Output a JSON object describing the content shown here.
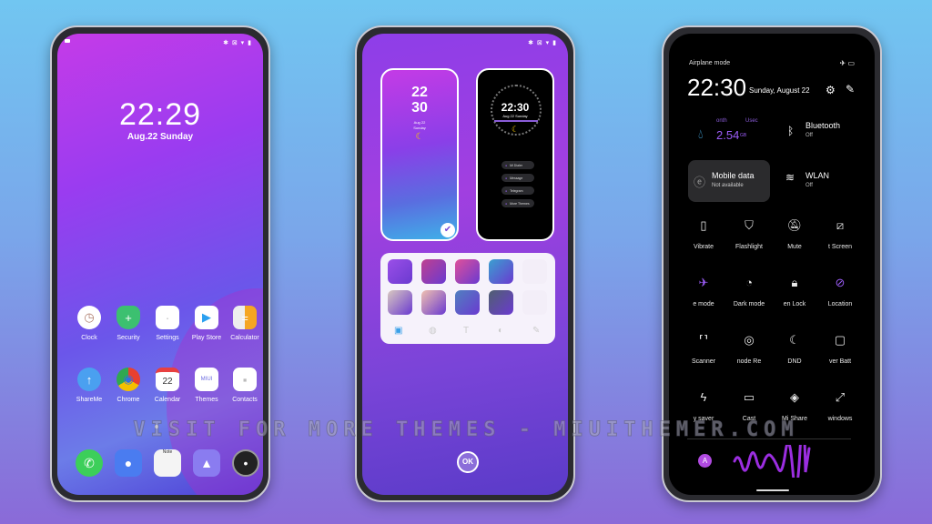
{
  "home": {
    "status_icons": "✱ ⊠ ▾ ▮",
    "time": "22:29",
    "date": "Aug.22  Sunday",
    "apps": [
      {
        "label": "Clock",
        "icon": "clock-icon",
        "glyph": "◷"
      },
      {
        "label": "Security",
        "icon": "shield-icon",
        "glyph": "+"
      },
      {
        "label": "Settings",
        "icon": "settings-icon",
        "glyph": "·"
      },
      {
        "label": "Play Store",
        "icon": "play-store-icon",
        "glyph": "▶"
      },
      {
        "label": "Calculator",
        "icon": "calculator-icon",
        "glyph": "="
      },
      {
        "label": "ShareMe",
        "icon": "shareme-icon",
        "glyph": "↑"
      },
      {
        "label": "Chrome",
        "icon": "chrome-icon",
        "glyph": "◉"
      },
      {
        "label": "Calendar",
        "icon": "calendar-icon",
        "glyph": "22"
      },
      {
        "label": "Themes",
        "icon": "themes-icon",
        "glyph": "MIUI"
      },
      {
        "label": "Contacts",
        "icon": "contacts-icon",
        "glyph": "▪"
      }
    ],
    "dock": [
      {
        "icon": "phone-icon",
        "glyph": "✆",
        "color": "#3ccf5a"
      },
      {
        "icon": "message-icon",
        "glyph": "●",
        "color": "#4a7cf0"
      },
      {
        "icon": "notes-icon",
        "glyph": "Note",
        "color": "#f4f4f4"
      },
      {
        "icon": "gallery-icon",
        "glyph": "▲",
        "color": "#8a7cf0"
      },
      {
        "icon": "camera-icon",
        "glyph": "•",
        "color": "#222"
      }
    ]
  },
  "themes": {
    "status_icons": "✱ ⊠ ▾ ▮",
    "lock_hour": "22",
    "lock_minute": "30",
    "lock_date": "Aug 22",
    "lock_day": "Sunday",
    "aod_time": "22:30",
    "aod_date": "Aug 22  Sunday",
    "aod_shortcuts": [
      "Mi Dialer",
      "Message",
      "Telegram",
      "More Themes"
    ],
    "ok_label": "OK",
    "thumb_colors": [
      "#9b4fe8",
      "#c04090",
      "#e0509a",
      "#3aa0d0",
      "#f3eef8",
      "#d9c8c0",
      "#f0c0b0",
      "#5080c0",
      "#506070",
      "#f3eef8"
    ],
    "tools": [
      "image-icon",
      "globe-icon",
      "text-icon",
      "palette-icon",
      "pen-icon"
    ]
  },
  "control_center": {
    "airplane_label": "Airplane mode",
    "time": "22:30",
    "date": "Sunday, August 22",
    "data_month": "onth",
    "data_used": "Usec",
    "data_value": "2.54",
    "data_unit": "GB",
    "bluetooth_label": "Bluetooth",
    "bluetooth_state": "Off",
    "mobile_label": "Mobile data",
    "mobile_state": "Not available",
    "wlan_label": "WLAN",
    "wlan_state": "Off",
    "accent": "#9b5cf6",
    "toggles": [
      {
        "label": "Vibrate",
        "glyph": "▯",
        "name": "vibrate-icon",
        "active": false
      },
      {
        "label": "Flashlight",
        "glyph": "⛉",
        "name": "flashlight-icon",
        "active": false
      },
      {
        "label": "Mute",
        "glyph": "🔕︎",
        "name": "mute-icon",
        "active": false
      },
      {
        "label": "t    Screen",
        "glyph": "⧄",
        "name": "screenshot-icon",
        "active": false
      },
      {
        "label": "e mode",
        "glyph": "✈",
        "name": "airplane-icon",
        "active": true
      },
      {
        "label": "Dark mode",
        "glyph": "◔",
        "name": "dark-mode-icon",
        "active": false
      },
      {
        "label": "en    Lock",
        "glyph": "🔒︎",
        "name": "lock-icon",
        "active": false
      },
      {
        "label": "Location",
        "glyph": "⊘",
        "name": "location-icon",
        "active": true
      },
      {
        "label": "Scanner",
        "glyph": "⸢⸣",
        "name": "scanner-icon",
        "active": false
      },
      {
        "label": "node    Re",
        "glyph": "◎",
        "name": "reading-mode-icon",
        "active": false
      },
      {
        "label": "DND",
        "glyph": "☾",
        "name": "dnd-icon",
        "active": false
      },
      {
        "label": "ver    Batt",
        "glyph": "▢",
        "name": "battery-icon",
        "active": false
      },
      {
        "label": "y saver",
        "glyph": "ϟ",
        "name": "power-saver-icon",
        "active": false
      },
      {
        "label": "Cast",
        "glyph": "▭",
        "name": "cast-icon",
        "active": false
      },
      {
        "label": "Mi Share",
        "glyph": "◈",
        "name": "mi-share-icon",
        "active": false
      },
      {
        "label": "windows",
        "glyph": "⤢",
        "name": "floating-windows-icon",
        "active": false
      }
    ],
    "avatar_letter": "A"
  },
  "watermark": "VISIT FOR MORE THEMES - MIUITHEMER.COM"
}
